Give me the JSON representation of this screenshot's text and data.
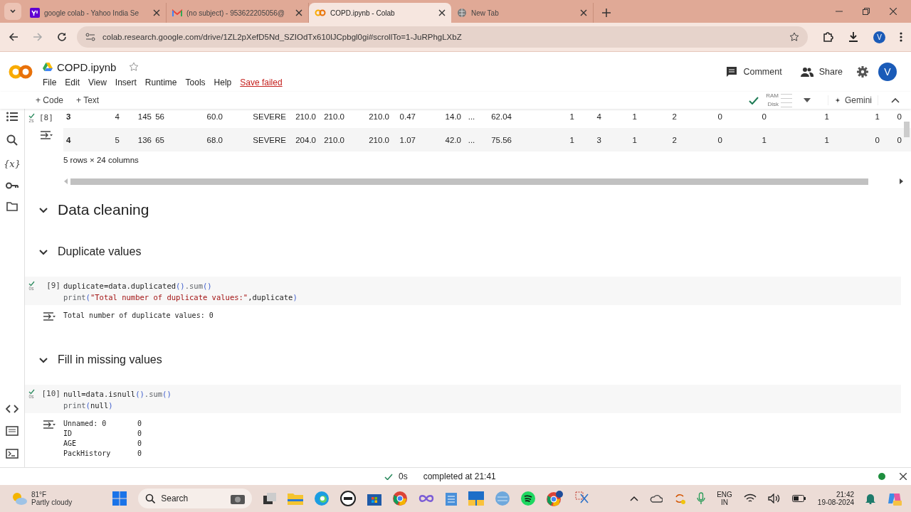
{
  "browser": {
    "tabs": [
      {
        "title": "google colab - Yahoo India Se",
        "kind": "yahoo",
        "selected": false
      },
      {
        "title": "(no subject) - 953622205056@",
        "kind": "mail",
        "selected": false
      },
      {
        "title": "COPD.ipynb - Colab",
        "kind": "colab",
        "selected": true
      },
      {
        "title": "New Tab",
        "kind": "globe",
        "selected": false
      }
    ],
    "url": "colab.research.google.com/drive/1ZL2pXefD5Nd_SZIOdTx610lJCpbgl0gi#scrollTo=1-JuRPhgLXbZ",
    "profile_initial": "V"
  },
  "notebook": {
    "title": "COPD.ipynb",
    "menu": [
      "File",
      "Edit",
      "View",
      "Insert",
      "Runtime",
      "Tools",
      "Help"
    ],
    "save_status": "Save failed",
    "comment": "Comment",
    "share": "Share",
    "avatar_initial": "V"
  },
  "toolbar": {
    "add_code": "+ Code",
    "add_text": "+ Text",
    "ram_label": "RAM",
    "disk_label": "Disk",
    "gemini": "Gemini"
  },
  "sidebar": {
    "variables_glyph": "{x}"
  },
  "cells": [
    {
      "kind": "table",
      "exec_count": "[8]",
      "duration": "2s",
      "rows": [
        [
          "3",
          "4",
          "145",
          "56",
          "60.0",
          "SEVERE",
          "210.0",
          "210.0",
          "210.0",
          "0.47",
          "14.0",
          "...",
          "62.04",
          "1",
          "4",
          "1",
          "2",
          "0",
          "0",
          "1",
          "1",
          "0"
        ],
        [
          "4",
          "5",
          "136",
          "65",
          "68.0",
          "SEVERE",
          "204.0",
          "210.0",
          "210.0",
          "1.07",
          "42.0",
          "...",
          "75.56",
          "1",
          "3",
          "1",
          "2",
          "0",
          "1",
          "1",
          "0",
          "0"
        ]
      ],
      "shape": "5 rows × 24 columns"
    },
    {
      "kind": "heading",
      "text": "Data cleaning",
      "expanded": true
    },
    {
      "kind": "subheading",
      "text": "Duplicate values",
      "expanded": true
    },
    {
      "kind": "code",
      "exec_count": "[9]",
      "duration": "0s",
      "lines": [
        [
          {
            "t": "duplicate=data.duplicated",
            "kind": "plain"
          },
          {
            "t": "()",
            "kind": "paren"
          },
          {
            "t": ".sum",
            "kind": "fn"
          },
          {
            "t": "()",
            "kind": "paren"
          }
        ],
        [
          {
            "t": "print",
            "kind": "fn"
          },
          {
            "t": "(",
            "kind": "paren"
          },
          {
            "t": "\"Total number of duplicate values:\"",
            "kind": "str"
          },
          {
            "t": ",duplicate",
            "kind": "plain"
          },
          {
            "t": ")",
            "kind": "paren"
          }
        ]
      ],
      "output": [
        [
          "Total number of duplicate values: 0"
        ]
      ]
    },
    {
      "kind": "subheading",
      "text": "Fill in missing values",
      "expanded": true
    },
    {
      "kind": "code",
      "exec_count": "[10]",
      "duration": "0s",
      "lines": [
        [
          {
            "t": "null=data.isnull",
            "kind": "plain"
          },
          {
            "t": "()",
            "kind": "paren"
          },
          {
            "t": ".sum",
            "kind": "fn"
          },
          {
            "t": "()",
            "kind": "paren"
          }
        ],
        [
          {
            "t": "print",
            "kind": "fn"
          },
          {
            "t": "(",
            "kind": "paren"
          },
          {
            "t": "null",
            "kind": "plain"
          },
          {
            "t": ")",
            "kind": "paren"
          }
        ]
      ],
      "output": [
        [
          "Unnamed: 0",
          "0"
        ],
        [
          "ID",
          "0"
        ],
        [
          "AGE",
          "0"
        ],
        [
          "PackHistory",
          "0"
        ]
      ]
    }
  ],
  "status_bar": {
    "duration": "0s",
    "message": "completed at 21:41",
    "connected": true
  },
  "taskbar": {
    "temperature": "81°F",
    "weather": "Partly cloudy",
    "search": "Search",
    "lang": "ENG",
    "region": "IN",
    "time": "21:42",
    "date": "19-08-2024"
  }
}
